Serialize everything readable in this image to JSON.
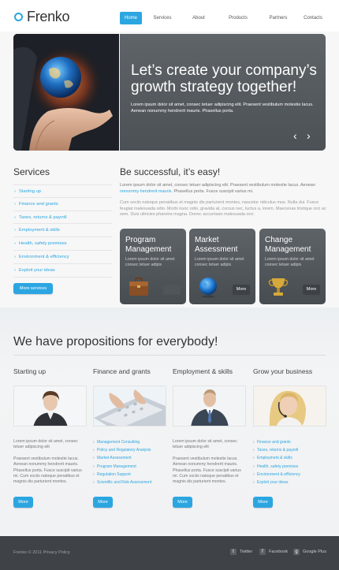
{
  "brand": {
    "name": "Frenko",
    "accent": "#2ba6e1"
  },
  "nav": {
    "items": [
      "Home",
      "Services",
      "About",
      "Products",
      "Partners",
      "Contacts"
    ],
    "active": "Home"
  },
  "hero": {
    "title_line1": "Let’s create your company’s",
    "title_line2": "growth strategy together!",
    "text": "Lorem ipsum dolor sit amet, consec tetuer adipiscing elit. Praesent vestibulum molestie lacus. Aenean nonummy hendrerit mauris. Phasellus porta.",
    "prev_icon": "chevron-left-icon",
    "next_icon": "chevron-right-icon"
  },
  "services": {
    "title": "Services",
    "items": [
      "Starting up",
      "Finance and grants",
      "Taxes, returns & payroll",
      "Employment & skills",
      "Health, safety premises",
      "Environment & efficiency",
      "Exploit your ideas"
    ],
    "button": "More services"
  },
  "successful": {
    "title": "Be successful, it’s easy!",
    "p1_start": "Lorem ipsum dolor sit amet, consec tetuer adipiscing elit. Praesent vestibulum molestie lacus. Aenean",
    "p1_link": "nonummy hendrerit mauris",
    "p1_end": ". Phasellus porta. Fusce suscipit varius mi.",
    "p2": "Cum sociis natoque penatibus et magnis dis parturient montes, nascetur ridiculus mus. Nulla dui. Fusce feugiat malesuada odio. Morbi nunc odio, gravida at, cursus nec, luctus a, lorem. Maecenas tristique orci ac sem. Duis ultricies pharetra magna. Donec accumsan malesuada orci."
  },
  "cards": [
    {
      "title_line1": "Program",
      "title_line2": "Management",
      "text": "Lorem ipsum dolor sit amet consec tetuer adipis",
      "button": "More",
      "icon": "briefcase-icon"
    },
    {
      "title_line1": "Market",
      "title_line2": "Assessment",
      "text": "Lorem ipsum dolor sit amet consec tetuer adipis",
      "button": "More",
      "icon": "globe-icon"
    },
    {
      "title_line1": "Change",
      "title_line2": "Management",
      "text": "Lorem ipsum dolor sit amet consec tetuer adipis",
      "button": "More",
      "icon": "trophy-icon"
    }
  ],
  "propositions": {
    "title": "We have propositions for everybody!",
    "columns": [
      {
        "title": "Starting up",
        "image": "smiling-businesswoman-image",
        "text1": "Lorem ipsum dolor sit amet, consec tetuer adipiscing elit",
        "text2": "Praesent vestibulum molestie lacus. Aenean nonummy hendrerit mauris. Phasellus porta. Fusce suscipit varius mi. Cum sociis natoque penatibus et magnis dis parturient montes.",
        "button": "More"
      },
      {
        "title": "Finance and grants",
        "image": "hands-on-keyboard-image",
        "links": [
          "Management Consulting",
          "Policy and Regulatory Analysis",
          "Market Assessment",
          "Program Management",
          "Regulation Support",
          "Scientific and Risk Assessment"
        ],
        "button": "More"
      },
      {
        "title": "Employment & skills",
        "image": "businessman-portrait-image",
        "text1": "Lorem ipsum dolor sit amet, consec tetuer adipiscing elit",
        "text2": "Praesent vestibulum molestie lacus. Aenean nonummy hendrerit mauris. Phasellus porta. Fusce suscipit varius mi. Cum sociis natoque penatibus et magnis dis parturient montes.",
        "button": "More"
      },
      {
        "title": "Grow your business",
        "image": "woman-with-headset-image",
        "links": [
          "Finance and grants",
          "Taxes, returns & payroll",
          "Employment & skills",
          "Health, safety premises",
          "Environment & efficiency",
          "Exploit your ideas"
        ],
        "button": "More"
      }
    ]
  },
  "footer": {
    "copyright": "Frenko © 2011 Privacy Policy",
    "social": [
      {
        "label": "Twitter",
        "icon": "twitter-icon"
      },
      {
        "label": "Facebook",
        "icon": "facebook-icon"
      },
      {
        "label": "Google Plus",
        "icon": "google-plus-icon"
      }
    ]
  }
}
